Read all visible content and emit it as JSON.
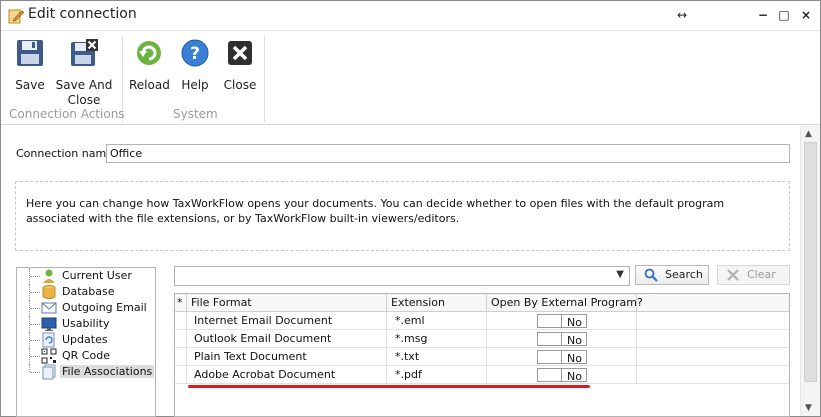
{
  "window": {
    "title": "Edit connection",
    "title_icon": "pencil-edit-icon",
    "controls": {
      "resize": "↔",
      "minimize": "−",
      "maximize": "□",
      "close": "×"
    }
  },
  "ribbon": {
    "buttons": {
      "save": {
        "label": "Save",
        "icon": "floppy-disk-icon"
      },
      "save_close_line1": "Save And",
      "save_close_line2": "Close",
      "save_close_icon": "floppy-close-icon",
      "reload": {
        "label": "Reload",
        "icon": "reload-icon"
      },
      "help": {
        "label": "Help",
        "icon": "help-icon"
      },
      "close": {
        "label": "Close",
        "icon": "close-icon"
      }
    },
    "groups": {
      "connection_actions": "Connection Actions",
      "system": "System"
    }
  },
  "form": {
    "connection_name_label": "Connection name:",
    "connection_name_value": "Office",
    "info_text": "Here you can change how TaxWorkFlow opens your documents. You can decide whether to open files with the default program associated with the file extensions, or by TaxWorkFlow built-in viewers/editors."
  },
  "tree": {
    "items": [
      {
        "label": "Current User",
        "icon": "user-icon"
      },
      {
        "label": "Database",
        "icon": "database-icon"
      },
      {
        "label": "Outgoing Email",
        "icon": "email-icon"
      },
      {
        "label": "Usability",
        "icon": "monitor-icon"
      },
      {
        "label": "Updates",
        "icon": "updates-icon"
      },
      {
        "label": "QR Code",
        "icon": "qr-code-icon"
      },
      {
        "label": "File Associations",
        "icon": "file-associations-icon"
      }
    ],
    "selected_index": 6
  },
  "search": {
    "combo_value": "",
    "search_label": "Search",
    "clear_label": "Clear"
  },
  "grid": {
    "headers": {
      "marker": "*",
      "file_format": "File Format",
      "extension": "Extension",
      "external": "Open By External Program?"
    },
    "rows": [
      {
        "file_format": "Internet Email Document",
        "extension": "*.eml",
        "external": "No"
      },
      {
        "file_format": "Outlook Email Document",
        "extension": "*.msg",
        "external": "No"
      },
      {
        "file_format": "Plain Text Document",
        "extension": "*.txt",
        "external": "No"
      },
      {
        "file_format": "Adobe Acrobat Document",
        "extension": "*.pdf",
        "external": "No"
      }
    ]
  },
  "colors": {
    "highlight_underline": "#e0161e",
    "tree_selection": "#dcdcdc"
  }
}
